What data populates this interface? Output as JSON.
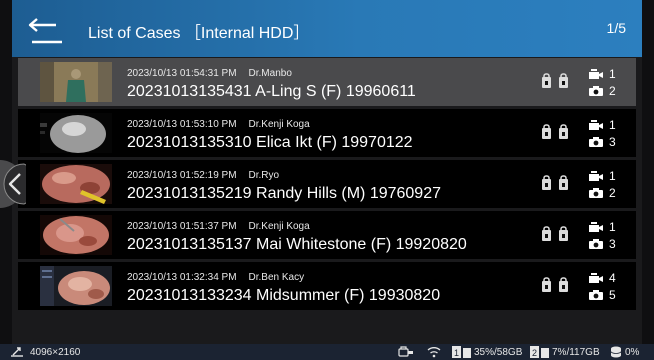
{
  "header": {
    "title": "List of Cases ［Internal HDD］",
    "page": "1/5",
    "colors": {
      "header_start": "#1d5d92",
      "header_end": "#2c7fbf",
      "selected_row": "#4a4a4c"
    }
  },
  "cases": [
    {
      "timestamp": "2023/10/13 01:54:31 PM",
      "doctor": "Dr.Manbo",
      "name": "20231013135431 A-Ling S (F) 19960611",
      "videos": "1",
      "photos": "2",
      "selected": true
    },
    {
      "timestamp": "2023/10/13 01:53:10 PM",
      "doctor": "Dr.Kenji Koga",
      "name": "20231013135310 Elica Ikt (F) 19970122",
      "videos": "1",
      "photos": "3",
      "selected": false
    },
    {
      "timestamp": "2023/10/13 01:52:19 PM",
      "doctor": "Dr.Ryo",
      "name": "20231013135219 Randy Hills (M) 19760927",
      "videos": "1",
      "photos": "2",
      "selected": false
    },
    {
      "timestamp": "2023/10/13 01:51:37 PM",
      "doctor": "Dr.Kenji Koga",
      "name": "20231013135137 Mai Whitestone (F) 19920820",
      "videos": "1",
      "photos": "3",
      "selected": false
    },
    {
      "timestamp": "2023/10/13 01:32:34 PM",
      "doctor": "Dr.Ben Kacy",
      "name": "20231013133234 Midsummer (F) 19930820",
      "videos": "4",
      "photos": "5",
      "selected": false
    }
  ],
  "status": {
    "resolution": "4096×2160",
    "drive1": "35%/58GB",
    "drive2": "7%/117GB",
    "storage": "0%"
  },
  "icons": [
    "back-arrow-icon",
    "chevron-left-icon",
    "protect-icon",
    "video-camera-icon",
    "camera-icon",
    "resolution-icon",
    "usb-icon",
    "wifi-icon",
    "sd-card-icon",
    "database-icon"
  ]
}
